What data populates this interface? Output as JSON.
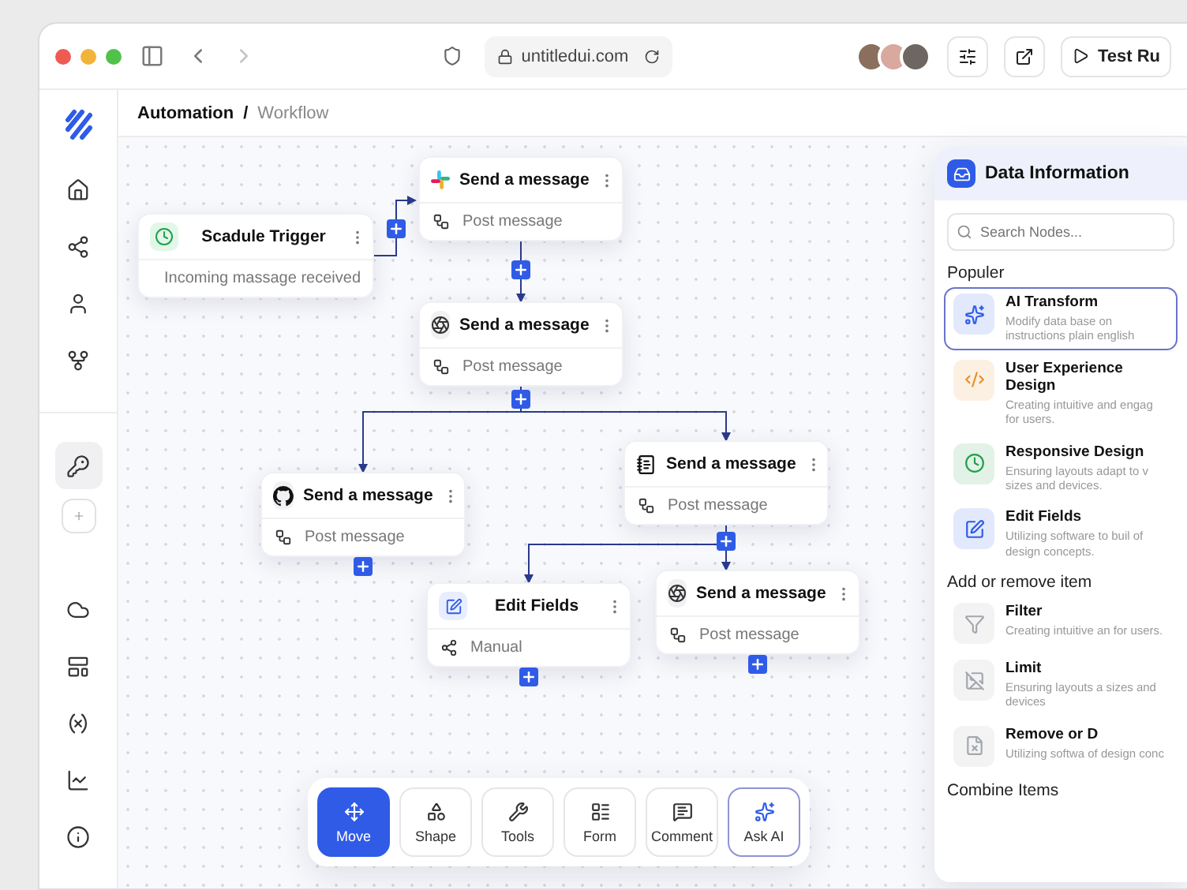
{
  "browser": {
    "url": "untitledui.com",
    "test_button": "Test Ru"
  },
  "breadcrumb": {
    "parent": "Automation",
    "separator": "/",
    "current": "Workflow"
  },
  "sidebar": {
    "nav": [
      {
        "kind": "home",
        "selected": false
      },
      {
        "kind": "share",
        "selected": false
      },
      {
        "kind": "user",
        "selected": false
      },
      {
        "kind": "fork",
        "selected": false
      }
    ],
    "tools": [
      {
        "kind": "key",
        "selected": true
      },
      {
        "kind": "add",
        "selected": false
      }
    ],
    "bottom": [
      {
        "kind": "cloud",
        "selected": false
      },
      {
        "kind": "layout",
        "selected": false
      },
      {
        "kind": "variable",
        "selected": false
      },
      {
        "kind": "chart",
        "selected": false
      },
      {
        "kind": "info",
        "selected": false
      }
    ]
  },
  "nodes": [
    {
      "title": "Scadule Trigger",
      "subtitle": "Incoming massage  received"
    },
    {
      "title": "Send a message",
      "subtitle": "Post message"
    },
    {
      "title": "Send a message",
      "subtitle": "Post message"
    },
    {
      "title": "Send a message",
      "subtitle": "Post message"
    },
    {
      "title": "Send a message",
      "subtitle": "Post message"
    },
    {
      "title": "Edit Fields",
      "subtitle": "Manual"
    },
    {
      "title": "Send a message",
      "subtitle": "Post message"
    }
  ],
  "toolbar": [
    {
      "kind": "move",
      "label": "Move",
      "selected": true
    },
    {
      "kind": "shape",
      "label": "Shape",
      "selected": false
    },
    {
      "kind": "tools",
      "label": "Tools",
      "selected": false
    },
    {
      "kind": "form",
      "label": "Form",
      "selected": false
    },
    {
      "kind": "comment",
      "label": "Comment",
      "selected": false
    },
    {
      "kind": "ai",
      "label": "Ask AI",
      "selected": false
    }
  ],
  "panel": {
    "title": "Data Information",
    "search": {
      "placeholder": "Search Nodes..."
    },
    "sections": [
      {
        "heading": "Populer",
        "items": [
          {
            "title": "AI Transform",
            "description": "Modify data base on instructions plain english",
            "color": "#2f5be7",
            "selected": true
          },
          {
            "title": "User Experience Design",
            "description": "Creating intuitive and engag for users.",
            "color": "#e8902c",
            "selected": false
          },
          {
            "title": "Responsive Design",
            "description": "Ensuring layouts adapt to v sizes and devices.",
            "color": "#22a04b",
            "selected": false
          },
          {
            "title": "Edit Fields",
            "description": "Utilizing software to buil of design concepts.",
            "color": "#2f5be7",
            "selected": false
          }
        ]
      },
      {
        "heading": "Add or remove item",
        "items": [
          {
            "title": "Filter",
            "description": "Creating intuitive an for users.",
            "color": "#a3a7ae",
            "selected": false
          },
          {
            "title": "Limit",
            "description": "Ensuring layouts a sizes and devices",
            "color": "#a3a7ae",
            "selected": false
          },
          {
            "title": "Remove or D",
            "description": "Utilizing softwa of design conc",
            "color": "#a3a7ae",
            "selected": false
          }
        ]
      },
      {
        "heading": "Combine Items"
      }
    ]
  }
}
